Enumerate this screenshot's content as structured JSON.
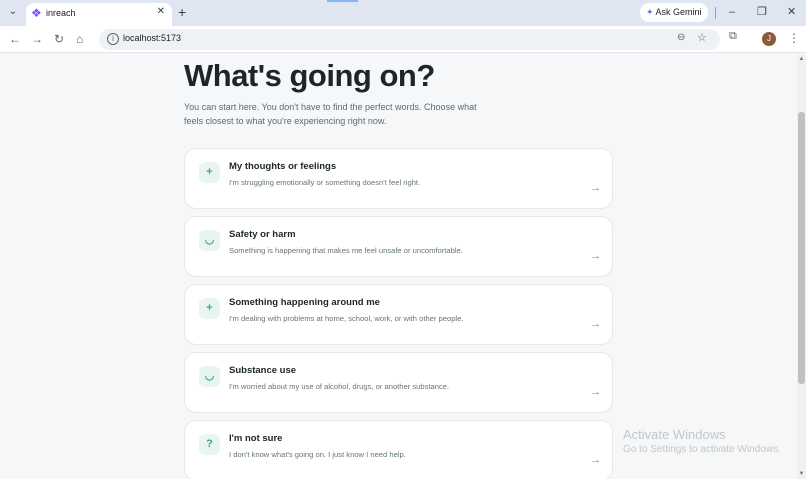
{
  "browser": {
    "tab_list_glyph": "⌄",
    "tab": {
      "favicon_glyph": "❖",
      "title": "inreach",
      "close_glyph": "✕"
    },
    "new_tab_glyph": "+",
    "gemini": {
      "star": "✦",
      "label": "Ask Gemini"
    },
    "window": {
      "minimize": "–",
      "restore": "❐",
      "close": "✕"
    },
    "nav": {
      "back": "←",
      "forward": "→",
      "reload": "↻",
      "home": "⌂"
    },
    "address": {
      "info_glyph": "i",
      "url": "localhost:5173",
      "zoom_glyph": "⊖",
      "bookmark_glyph": "☆"
    },
    "extensions_glyph": "⧉",
    "profile_initial": "J",
    "menu_glyph": "⋮",
    "colors": {
      "tabstrip": "#dfe6f1",
      "accent": "#3ea889"
    }
  },
  "page": {
    "title": "What's going on?",
    "intro": "You can start here. You don't have to find the perfect words. Choose what feels closest to what you're experiencing right now.",
    "cards": [
      {
        "icon": "+",
        "icon_name": "plus-icon",
        "title": "My thoughts or feelings",
        "description": "I'm struggling emotionally or something doesn't feel right.",
        "arrow": "→"
      },
      {
        "icon": "◡",
        "icon_name": "shield-icon",
        "title": "Safety or harm",
        "description": "Something is happening that makes me feel unsafe or uncomfortable.",
        "arrow": "→"
      },
      {
        "icon": "+",
        "icon_name": "plus-icon",
        "title": "Something happening around me",
        "description": "I'm dealing with problems at home, school, work, or with other people.",
        "arrow": "→"
      },
      {
        "icon": "◡",
        "icon_name": "shield-icon",
        "title": "Substance use",
        "description": "I'm worried about my use of alcohol, drugs, or another substance.",
        "arrow": "→"
      },
      {
        "icon": "?",
        "icon_name": "question-icon",
        "title": "I'm not sure",
        "description": "I don't know what's going on. I just know I need help.",
        "arrow": "→"
      }
    ]
  },
  "watermark": {
    "title": "Activate Windows",
    "subtitle": "Go to Settings to activate Windows."
  },
  "scrollbar": {
    "up": "▲",
    "down": "▼"
  }
}
